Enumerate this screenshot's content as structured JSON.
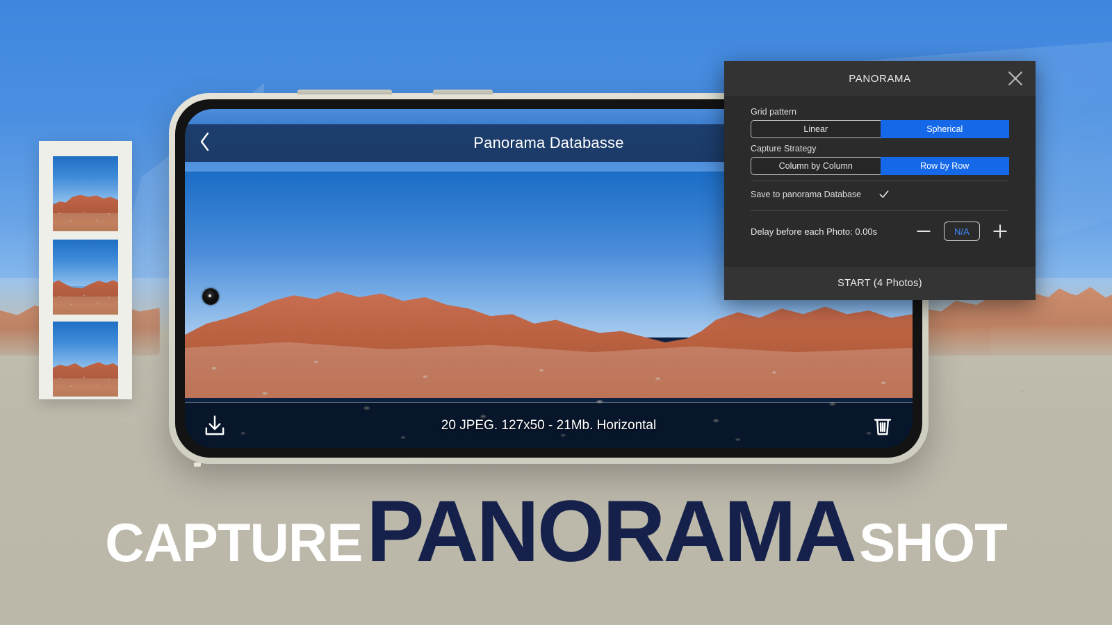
{
  "background": {
    "sky_color": "#4a8fe1",
    "ground_color": "#bcb9ab",
    "scene": "desert-landscape"
  },
  "filmstrip": {
    "name": "photo-filmstrip",
    "frame_count": 3
  },
  "phone": {
    "frame_color": "#dcdace",
    "orientation": "landscape"
  },
  "app": {
    "header": {
      "back_icon": "chevron-left-icon",
      "title": "Panorama Databasse"
    },
    "preview": {
      "camera_dot": "front-camera-punch-hole"
    },
    "bottom_bar": {
      "download_icon": "download-icon",
      "status_text": "20 JPEG. 127x50 - 21Mb. Horizontal",
      "delete_icon": "trash-icon"
    }
  },
  "dialog": {
    "title": "PANORAMA",
    "close_icon": "close-icon",
    "grid_pattern": {
      "label": "Grid pattern",
      "options": [
        "Linear",
        "Spherical"
      ],
      "selected": "Spherical"
    },
    "capture_strategy": {
      "label": "Capture Strategy",
      "options": [
        "Column by Column",
        "Row by Row"
      ],
      "selected": "Row by Row"
    },
    "save_to_db": {
      "label": "Save to panorama Database",
      "checked": true,
      "check_icon": "checkmark-icon"
    },
    "delay": {
      "label": "Delay before each Photo: 0.00s",
      "minus_icon": "minus-icon",
      "value": "N/A",
      "plus_icon": "plus-icon"
    },
    "start_button": "START (4 Photos)",
    "accent_color": "#1569e8",
    "value_color": "#3d8bfd",
    "surface_color": "#2b2b2b"
  },
  "headline": {
    "word1": "CAPTURE",
    "word2": "PANORAMA",
    "word3": "SHOT",
    "accent_color": "#15214a",
    "light_color": "#ffffff"
  }
}
